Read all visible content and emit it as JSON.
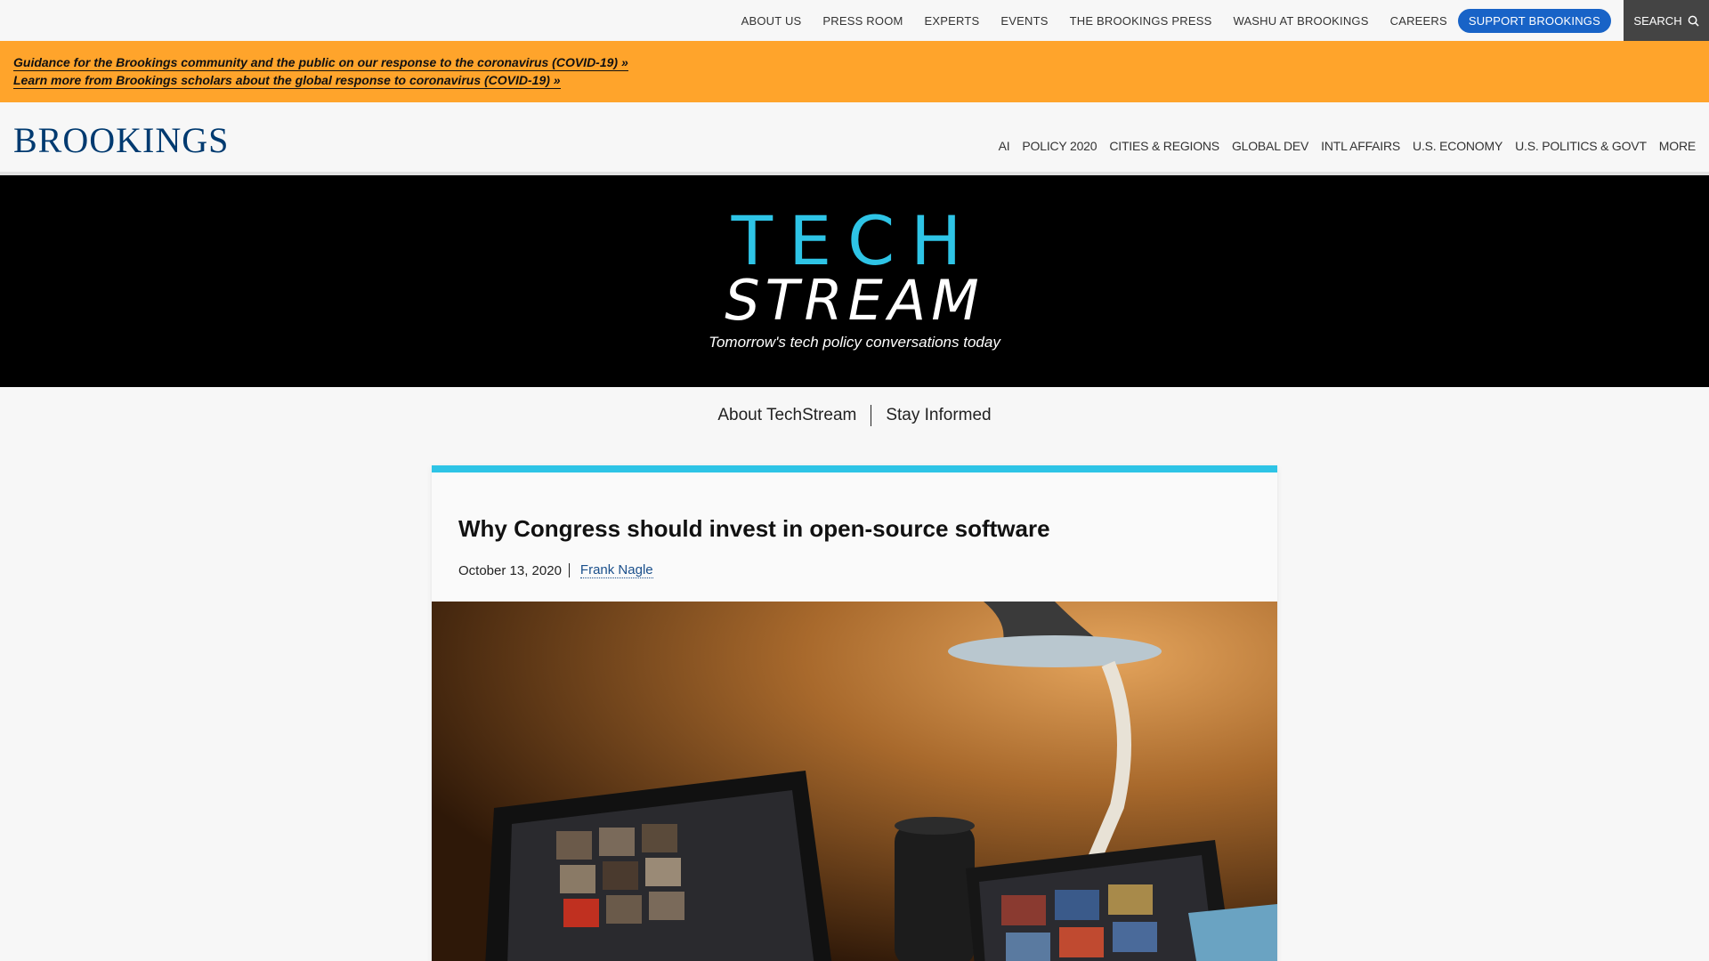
{
  "utility_nav": {
    "items": [
      "ABOUT US",
      "PRESS ROOM",
      "EXPERTS",
      "EVENTS",
      "THE BROOKINGS PRESS",
      "WASHU AT BROOKINGS",
      "CAREERS"
    ],
    "support_label": "SUPPORT BROOKINGS",
    "search_label": "SEARCH"
  },
  "alert": {
    "links": [
      "Guidance for the Brookings community and the public on our response to the coronavirus (COVID-19) »",
      "Learn more from Brookings scholars about the global response to coronavirus (COVID-19) »"
    ]
  },
  "header": {
    "logo": "BROOKINGS",
    "sections": [
      "AI",
      "POLICY 2020",
      "CITIES & REGIONS",
      "GLOBAL DEV",
      "INTL AFFAIRS",
      "U.S. ECONOMY",
      "U.S. POLITICS & GOVT",
      "MORE"
    ]
  },
  "banner": {
    "logo_line1": "TECH",
    "logo_line2": "STREAM",
    "tagline": "Tomorrow's tech policy conversations today",
    "accent_color": "#2ec4e6"
  },
  "subnav": {
    "about": "About TechStream",
    "stay": "Stay Informed"
  },
  "article": {
    "title": "Why Congress should invest in open-source software",
    "date": "October 13, 2020",
    "author": "Frank Nagle"
  }
}
